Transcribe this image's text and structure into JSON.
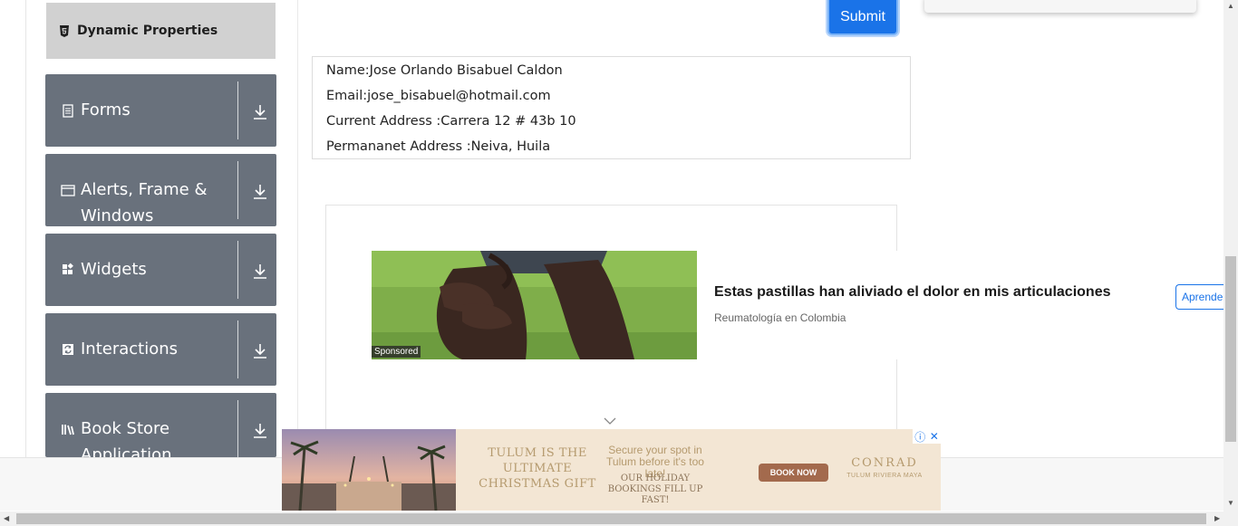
{
  "sidebar": {
    "active_item": "Dynamic Properties",
    "groups": [
      {
        "label": "Forms",
        "icon": "form-icon"
      },
      {
        "label": "Alerts, Frame & Windows",
        "icon": "window-icon"
      },
      {
        "label": "Widgets",
        "icon": "widgets-icon"
      },
      {
        "label": "Interactions",
        "icon": "interactions-icon"
      },
      {
        "label": "Book Store Application",
        "icon": "book-icon"
      }
    ]
  },
  "form": {
    "submit_label": "Submit"
  },
  "output": {
    "name": "Name:Jose Orlando Bisabuel Caldon",
    "email": "Email:jose_bisabuel@hotmail.com",
    "current_address": "Current Address :Carrera 12 # 43b 10",
    "permanent_address": "Permananet Address :Neiva, Huila"
  },
  "ad": {
    "title": "Estas pastillas han aliviado el dolor en mis articulaciones",
    "source": "Reumatología en Colombia",
    "cta": "Aprende",
    "sponsored": "Sponsored"
  },
  "banner": {
    "headline": "TULUM IS THE ULTIMATE CHRISTMAS GIFT",
    "tagline": "Secure your spot in Tulum before it's too late!",
    "subline": "OUR HOLIDAY BOOKINGS FILL UP FAST!",
    "button": "BOOK NOW",
    "brand": "CONRAD",
    "brand_sub": "TULUM RIVIERA MAYA"
  },
  "colors": {
    "menu_group_bg": "#69717c",
    "menu_active_bg": "#d1d1d1",
    "submit_bg": "#1a73e8"
  }
}
